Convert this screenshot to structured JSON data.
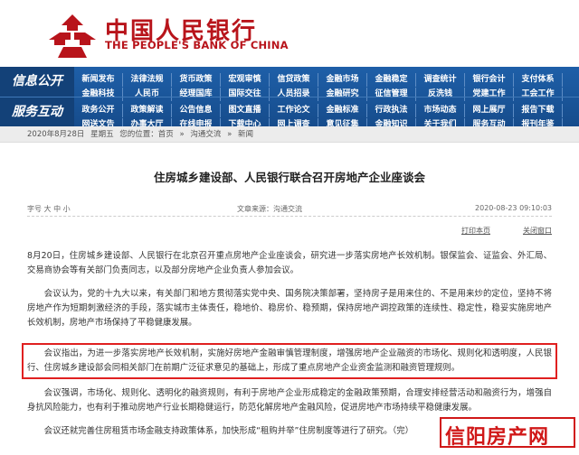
{
  "header": {
    "logo_cn": "中国人民银行",
    "logo_en": "THE PEOPLE'S BANK OF CHINA",
    "brand_color": "#b8141b"
  },
  "nav": {
    "section1_label": "信息公开",
    "section2_label": "服务互动",
    "row1": [
      "新闻发布",
      "法律法规",
      "货币政策",
      "宏观审慎",
      "信贷政策",
      "金融市场",
      "金融稳定",
      "调查统计",
      "银行会计",
      "支付体系"
    ],
    "row2": [
      "金融科技",
      "人民币",
      "经理国库",
      "国际交往",
      "人员招录",
      "金融研究",
      "征信管理",
      "反洗钱",
      "党建工作",
      "工会工作"
    ],
    "row3": [
      "政务公开",
      "政策解读",
      "公告信息",
      "图文直播",
      "工作论文",
      "金融标准",
      "行政执法",
      "市场动态",
      "网上展厅",
      "报告下载"
    ],
    "row4": [
      "网送文告",
      "办事大厅",
      "在线申报",
      "下载中心",
      "网上调查",
      "意见征集",
      "金融知识",
      "关于我们"
    ],
    "row3_extra": "服务互动",
    "row4_extra": "报刊年鉴",
    "accent_color": "#1e5fa8"
  },
  "breadcrumb": {
    "date": "2020年8月28日",
    "weekday": "星期五",
    "location_label": "您的位置：首页",
    "sep": "»",
    "level2": "沟通交流",
    "level3": "新闻"
  },
  "article": {
    "title": "住房城乡建设部、人民银行联合召开房地产企业座谈会",
    "font_size_label": "字号",
    "font_size_options": "大 中 小",
    "source": "文章来源：沟通交流",
    "datetime": "2020-08-23 09:10:03",
    "print_label": "打印本页",
    "close_label": "关闭窗口",
    "paragraphs": [
      "8月20日，住房城乡建设部、人民银行在北京召开重点房地产企业座谈会，研究进一步落实房地产长效机制。银保监会、证监会、外汇局、交易商协会等有关部门负责同志，以及部分房地产企业负责人参加会议。",
      "会议认为，党的十九大以来，有关部门和地方贯彻落实党中央、国务院决策部署，坚持房子是用来住的、不是用来炒的定位，坚持不将房地产作为短期刺激经济的手段，落实城市主体责任，稳地价、稳房价、稳预期，保持房地产调控政策的连续性、稳定性，稳妥实施房地产长效机制，房地产市场保持了平稳健康发展。",
      "会议指出，为进一步落实房地产长效机制，实施好房地产金融审慎管理制度，增强房地产企业融资的市场化、规则化和透明度，人民银行、住房城乡建设部会同相关部门在前期广泛征求意见的基础上，形成了重点房地产企业资金监测和融资管理规则。",
      "会议强调，市场化、规则化、透明化的融资规则，有利于房地产企业形成稳定的金融政策预期，合理安排经营活动和融资行为，增强自身抗风险能力，也有利于推动房地产行业长期稳健运行，防范化解房地产金融风险，促进房地产市场持续平稳健康发展。",
      "会议还就完善住房租赁市场金融支持政策体系，加快形成“租购并举”住房制度等进行了研究。（完）"
    ]
  },
  "watermark": {
    "text": "信阳房产网",
    "color": "#d01818"
  }
}
